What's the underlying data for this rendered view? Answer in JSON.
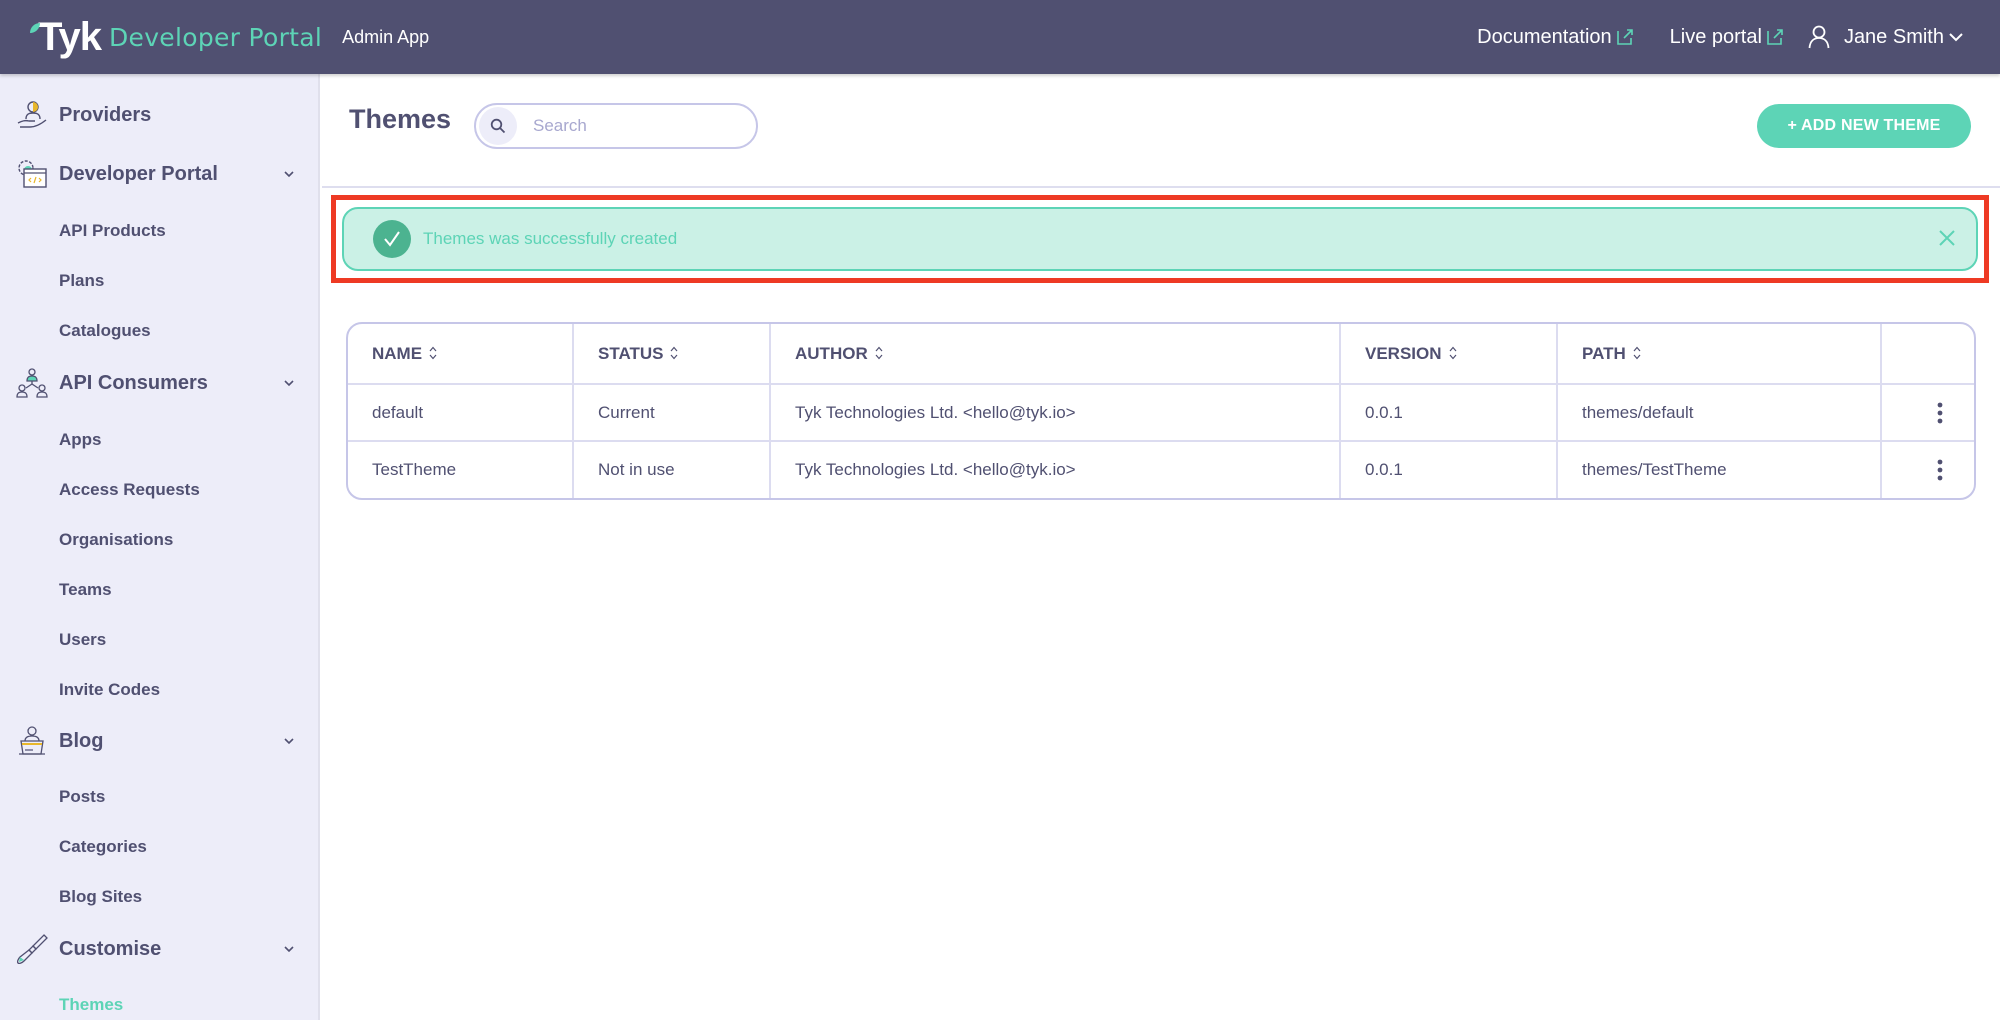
{
  "topbar": {
    "logo_text": "Tyk",
    "product_name": "Developer Portal",
    "app_name": "Admin App",
    "links": [
      {
        "label": "Documentation",
        "icon": "external-link-icon"
      },
      {
        "label": "Live portal",
        "icon": "external-link-icon"
      }
    ],
    "user": {
      "name": "Jane Smith",
      "icon": "user-icon"
    }
  },
  "sidebar": {
    "sections": [
      {
        "label": "Providers",
        "icon": "providers-hand-icon",
        "expandable": false,
        "items": []
      },
      {
        "label": "Developer Portal",
        "icon": "developer-portal-icon",
        "expandable": true,
        "items": [
          "API Products",
          "Plans",
          "Catalogues"
        ]
      },
      {
        "label": "API Consumers",
        "icon": "api-consumers-icon",
        "expandable": true,
        "items": [
          "Apps",
          "Access Requests",
          "Organisations",
          "Teams",
          "Users",
          "Invite Codes"
        ]
      },
      {
        "label": "Blog",
        "icon": "blog-icon",
        "expandable": true,
        "items": [
          "Posts",
          "Categories",
          "Blog Sites"
        ]
      },
      {
        "label": "Customise",
        "icon": "paintbrush-icon",
        "expandable": true,
        "items": [
          "Themes"
        ]
      }
    ],
    "active_item": "Themes"
  },
  "page": {
    "title": "Themes",
    "search_placeholder": "Search",
    "search_value": "",
    "add_button_label": "+ ADD NEW THEME"
  },
  "alert": {
    "message": "Themes was successfully created",
    "type": "success"
  },
  "table": {
    "columns": [
      "NAME",
      "STATUS",
      "AUTHOR",
      "VERSION",
      "PATH"
    ],
    "rows": [
      {
        "name": "default",
        "status": "Current",
        "author": "Tyk Technologies Ltd. <hello@tyk.io>",
        "version": "0.0.1",
        "path": "themes/default"
      },
      {
        "name": "TestTheme",
        "status": "Not in use",
        "author": "Tyk Technologies Ltd. <hello@tyk.io>",
        "version": "0.0.1",
        "path": "themes/TestTheme"
      }
    ]
  },
  "colors": {
    "topbar_bg": "#505071",
    "accent": "#5dd4b6",
    "sidebar_bg": "#ededf9",
    "alert_bg": "#cbf1e6",
    "highlight": "#ee3a24",
    "text_primary": "#505071"
  }
}
